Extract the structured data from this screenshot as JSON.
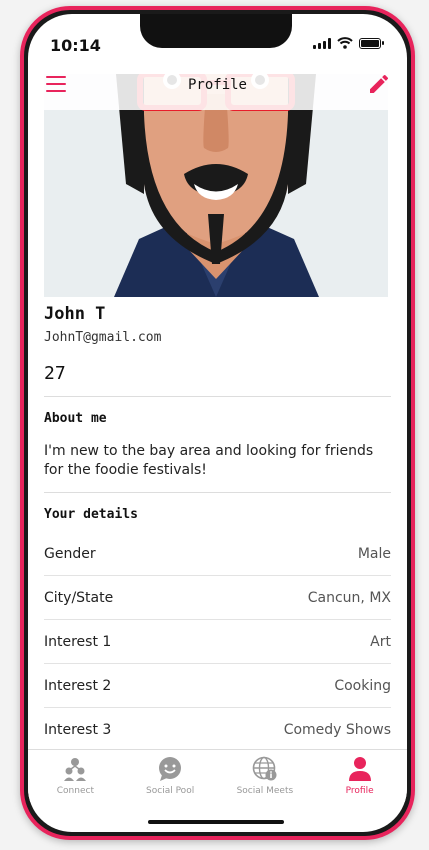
{
  "status_bar": {
    "time": "10:14"
  },
  "header": {
    "title": "Profile",
    "menu_icon": "hamburger-menu-icon",
    "edit_icon": "pencil-icon"
  },
  "profile": {
    "name": "John T",
    "email": "JohnT@gmail.com",
    "age": "27",
    "about_title": "About me",
    "about_text": "I'm new to the bay area and looking for friends for the foodie festivals!",
    "details_title": "Your details",
    "details": [
      {
        "label": "Gender",
        "value": "Male"
      },
      {
        "label": "City/State",
        "value": "Cancun, MX"
      },
      {
        "label": "Interest 1",
        "value": "Art"
      },
      {
        "label": "Interest 2",
        "value": "Cooking"
      },
      {
        "label": "Interest 3",
        "value": "Comedy Shows"
      }
    ]
  },
  "tabs": [
    {
      "label": "Connect",
      "icon": "people-icon",
      "active": false
    },
    {
      "label": "Social Pool",
      "icon": "chat-bubble-icon",
      "active": false
    },
    {
      "label": "Social Meets",
      "icon": "globe-info-icon",
      "active": false
    },
    {
      "label": "Profile",
      "icon": "person-icon",
      "active": true
    }
  ],
  "colors": {
    "accent": "#e8245c",
    "inactive": "#999999"
  }
}
